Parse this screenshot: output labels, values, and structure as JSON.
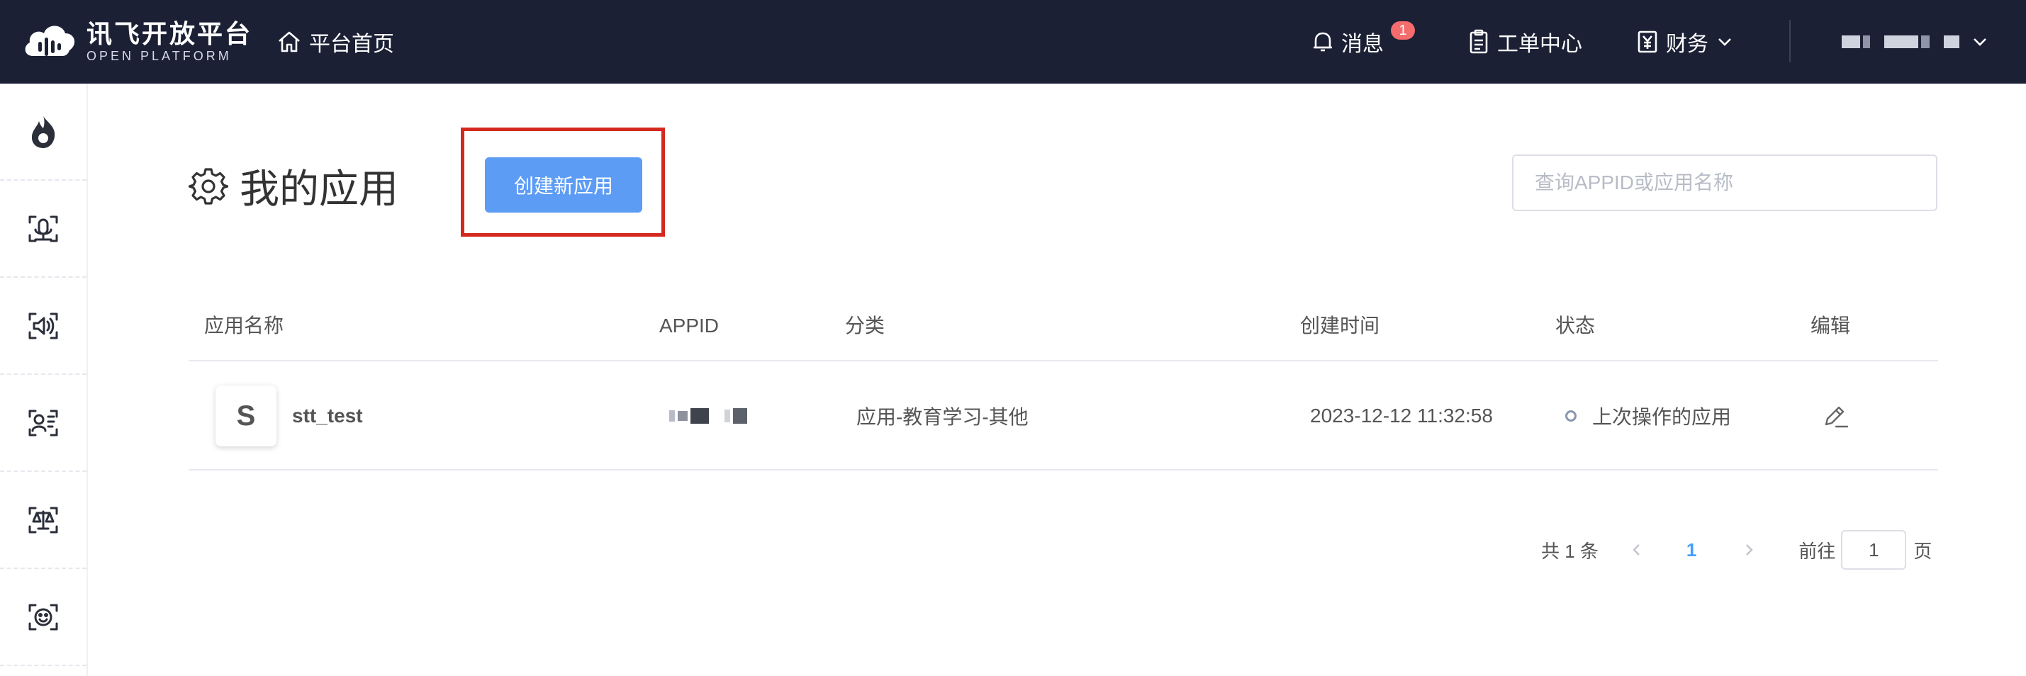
{
  "header": {
    "logo_cn": "讯飞开放平台",
    "logo_en": "OPEN PLATFORM",
    "home_label": "平台首页",
    "messages_label": "消息",
    "messages_badge": "1",
    "workorder_label": "工单中心",
    "finance_label": "财务"
  },
  "sidebar": {
    "icons": [
      "flame-icon",
      "mic-scan-icon",
      "speaker-icon",
      "voice-text-icon",
      "balance-icon",
      "face-scan-icon"
    ]
  },
  "main": {
    "title": "我的应用",
    "create_button": "创建新应用",
    "search_placeholder": "查询APPID或应用名称"
  },
  "table": {
    "headers": [
      "应用名称",
      "APPID",
      "分类",
      "创建时间",
      "状态",
      "编辑"
    ],
    "rows": [
      {
        "avatar": "S",
        "name": "stt_test",
        "category": "应用-教育学习-其他",
        "created": "2023-12-12 11:32:58",
        "status": "上次操作的应用"
      }
    ]
  },
  "pagination": {
    "total_text": "共 1 条",
    "current_page": "1",
    "goto_label": "前往",
    "goto_value": "1",
    "page_suffix": "页"
  },
  "colors": {
    "topbar": "#1b2035",
    "primary": "#5c9cf4",
    "highlight": "#d4281e",
    "badge": "#f56c6c"
  }
}
